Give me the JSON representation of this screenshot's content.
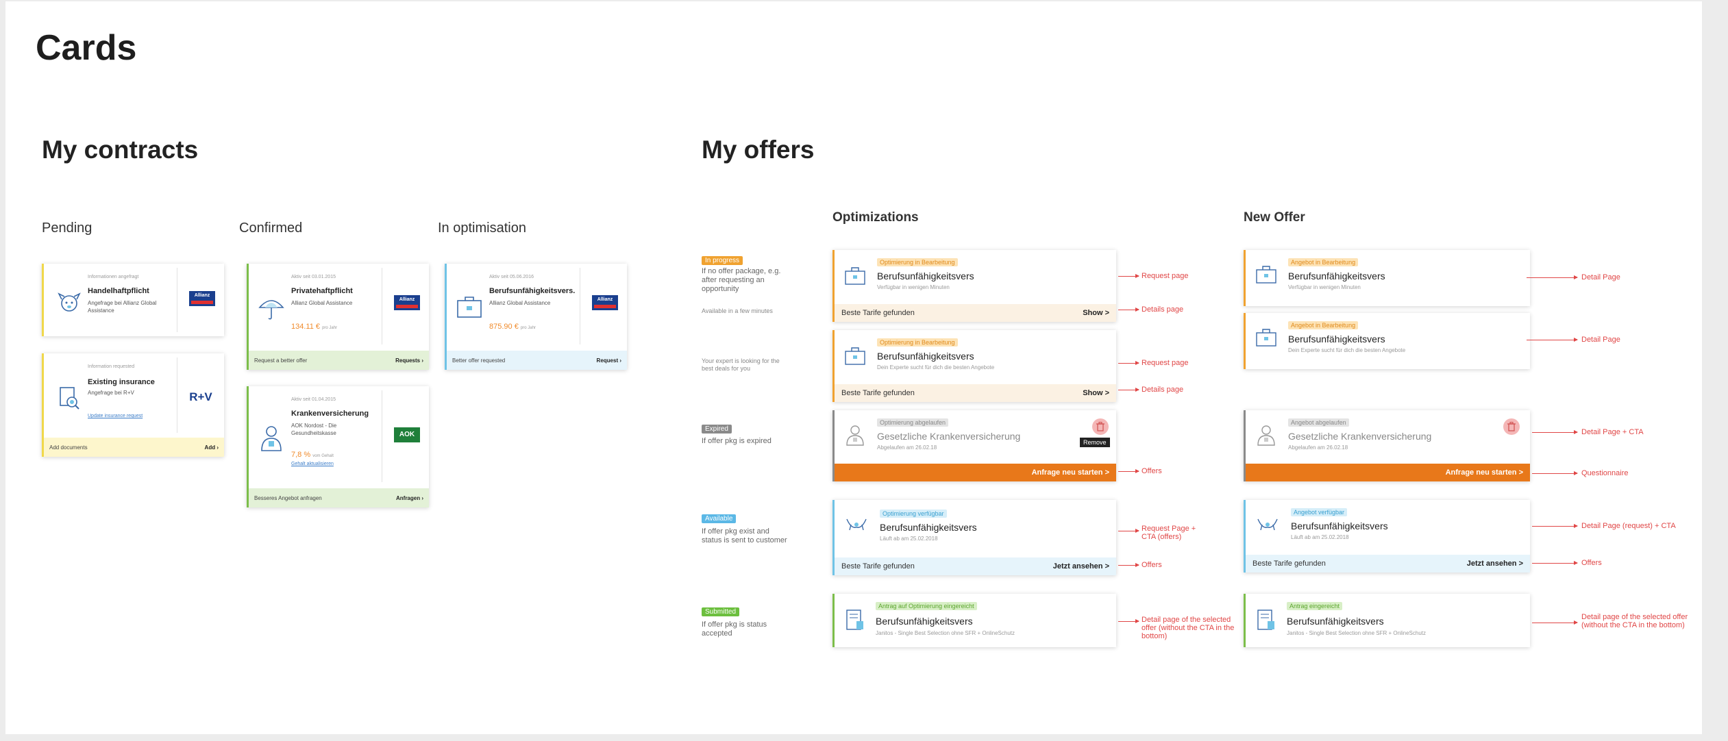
{
  "page_title": "Cards",
  "contracts": {
    "heading": "My contracts",
    "col_pending": "Pending",
    "col_confirmed": "Confirmed",
    "col_optimisation": "In optimisation",
    "pending_1": {
      "tiny": "Informationen angefragt",
      "title": "Handelhaftpflicht",
      "sub": "Angefrage bei Allianz Global Assistance",
      "logo": "Allianz"
    },
    "pending_2": {
      "tiny": "Information requested",
      "title": "Existing insurance",
      "sub": "Angefrage bei R+V",
      "link": "Update insurance request",
      "logo": "R+V",
      "foot_left": "Add documents",
      "foot_right": "Add"
    },
    "confirmed_1": {
      "tiny": "Aktiv seit 03.01.2015",
      "title": "Privatehaftpflicht",
      "sub": "Allianz Global Assistance",
      "price": "134.11 €",
      "unit": "pro Jahr",
      "logo": "Allianz",
      "foot_left": "Request a better offer",
      "foot_right": "Requests"
    },
    "confirmed_2": {
      "tiny": "Aktiv seit 01.04.2015",
      "title": "Krankenversicherung",
      "sub": "AOK Nordost - Die Gesundheitskasse",
      "price": "7,8 %",
      "unit": "vom Gehalt",
      "link": "Gehalt aktualisieren",
      "logo": "AOK",
      "foot_left": "Besseres Angebot anfragen",
      "foot_right": "Anfragen"
    },
    "optim_1": {
      "tiny": "Aktiv seit 05.06.2016",
      "title": "Berufsunfähigkeitsvers.",
      "sub": "Allianz Global Assistance",
      "price": "875.90 €",
      "unit": "pro Jahr",
      "logo": "Allianz",
      "foot_left": "Better offer requested",
      "foot_right": "Request"
    }
  },
  "offers": {
    "heading": "My offers",
    "col_optimizations": "Optimizations",
    "col_new": "New Offer",
    "rows": {
      "progress": {
        "badge": "In progress",
        "desc": "If no offer package, e.g. after requesting an opportunity",
        "note1": "Available in a few minutes",
        "note2": "Your expert is looking for the best deals for you"
      },
      "expired": {
        "badge": "Expired",
        "desc": "If offer pkg is expired"
      },
      "available": {
        "badge": "Available",
        "desc": "If offer pkg exist and status is sent to customer"
      },
      "submitted": {
        "badge": "Submitted",
        "desc": "If offer pkg is status accepted"
      }
    },
    "opt": {
      "c1": {
        "tag": "Optimierung in Bearbeitung",
        "title": "Berufsunfähigkeitsvers",
        "sub": "Verfügbar in wenigen Minuten",
        "foot_left": "Beste Tarife gefunden",
        "foot_right": "Show >"
      },
      "c2": {
        "tag": "Optimierung in Bearbeitung",
        "title": "Berufsunfähigkeitsvers",
        "sub": "Dein Experte sucht für dich die besten Angebote",
        "foot_left": "Beste Tarife gefunden",
        "foot_right": "Show >"
      },
      "c3": {
        "tag": "Optimierung abgelaufen",
        "title": "Gesetzliche Krankenversicherung",
        "sub": "Abgelaufen am 26.02.18",
        "tooltip": "Remove",
        "cta": "Anfrage neu starten >"
      },
      "c4": {
        "tag": "Optimierung verfügbar",
        "title": "Berufsunfähigkeitsvers",
        "sub": "Läuft ab am 25.02.2018",
        "foot_left": "Beste Tarife gefunden",
        "foot_right": "Jetzt ansehen >"
      },
      "c5": {
        "tag": "Antrag auf Optimierung eingereicht",
        "title": "Berufsunfähigkeitsvers",
        "sub": "Janitos - Single Best Selection ohne SFR + OnlineSchutz"
      }
    },
    "new": {
      "c1": {
        "tag": "Angebot in Bearbeitung",
        "title": "Berufsunfähigkeitsvers",
        "sub": "Verfügbar in wenigen Minuten"
      },
      "c2": {
        "tag": "Angebot in Bearbeitung",
        "title": "Berufsunfähigkeitsvers",
        "sub": "Dein Experte sucht für dich die besten Angebote"
      },
      "c3": {
        "tag": "Angebot abgelaufen",
        "title": "Gesetzliche Krankenversicherung",
        "sub": "Abgelaufen am 26.02.18",
        "cta": "Anfrage neu starten >"
      },
      "c4": {
        "tag": "Angebot verfügbar",
        "title": "Berufsunfähigkeitsvers",
        "sub": "Läuft ab am 25.02.2018",
        "foot_left": "Beste Tarife gefunden",
        "foot_right": "Jetzt ansehen >"
      },
      "c5": {
        "tag": "Antrag eingereicht",
        "title": "Berufsunfähigkeitsvers",
        "sub": "Janitos - Single Best Selection ohne SFR + OnlineSchutz"
      }
    },
    "annotations": {
      "opt_request_page": "Request page",
      "opt_details_page": "Details page",
      "opt_offers": "Offers",
      "opt_request_cta": "Request Page + CTA (offers)",
      "opt_detail_selected": "Detail page of the selected offer (without the CTA in the bottom)",
      "new_detail_page": "Detail Page",
      "new_detail_cta": "Detail Page + CTA",
      "new_questionnaire": "Questionnaire",
      "new_detail_request_cta": "Detail Page (request) + CTA",
      "new_offers": "Offers",
      "new_detail_selected": "Detail page of the selected offer (without the CTA in the bottom)"
    }
  },
  "colors": {
    "orange": "#e8781a",
    "yellow": "#f0d84a",
    "green": "#7cbe4a",
    "blue": "#6fc3e6",
    "red": "#e04646"
  }
}
